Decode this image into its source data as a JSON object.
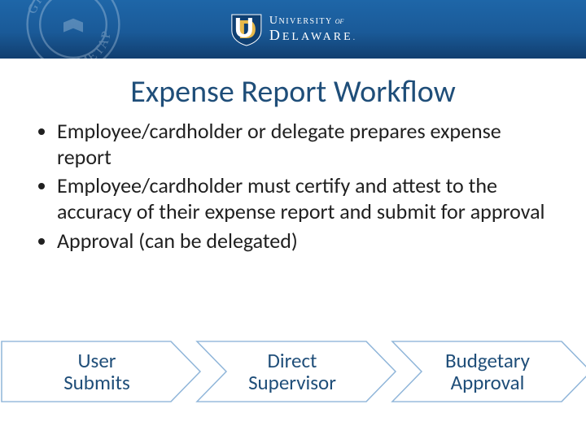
{
  "header": {
    "seal_top": "GRAMM",
    "seal_bottom": "METAP",
    "logo_line1_word": "NIVERSITY",
    "logo_line1_first": "U",
    "logo_line1_of": "OF",
    "logo_line2_first": "D",
    "logo_line2_word": "ELAWARE",
    "logo_line2_dot": "."
  },
  "title": "Expense Report Workflow",
  "bullets": [
    "Employee/cardholder or delegate prepares expense report",
    "Employee/cardholder must certify and attest to the accuracy of their expense report and submit for approval",
    "Approval (can be delegated)"
  ],
  "chevrons": [
    {
      "line1": "User",
      "line2": "Submits"
    },
    {
      "line1": "Direct",
      "line2": "Supervisor"
    },
    {
      "line1": "Budgetary",
      "line2": "Approval"
    }
  ],
  "colors": {
    "brand": "#1F4E79",
    "chev_fill": "#ffffff",
    "chev_stroke": "#3d7bb5"
  }
}
